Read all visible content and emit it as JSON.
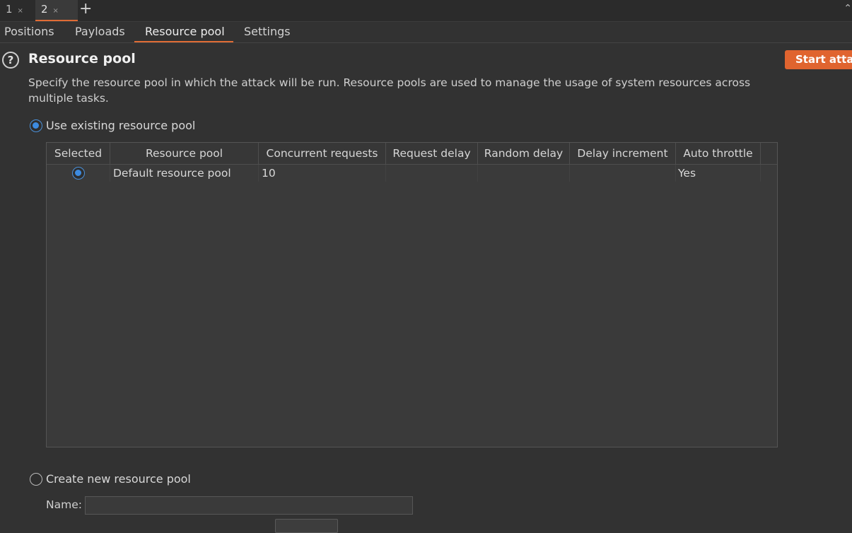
{
  "tabs": [
    {
      "label": "1",
      "close": "×"
    },
    {
      "label": "2",
      "close": "×"
    }
  ],
  "add_tab_icon": "+",
  "subtabs": [
    "Positions",
    "Payloads",
    "Resource pool",
    "Settings"
  ],
  "active_subtab": "Resource pool",
  "section": {
    "title": "Resource pool",
    "help_icon": "?",
    "description": "Specify the resource pool in which the attack will be run. Resource pools are used to manage the usage of system resources across multiple tasks.",
    "start_button": "Start attack"
  },
  "options": {
    "use_existing": "Use existing resource pool",
    "create_new": "Create new resource pool",
    "selected": "use_existing"
  },
  "table": {
    "columns": [
      "Selected",
      "Resource pool",
      "Concurrent requests",
      "Request delay",
      "Random delay",
      "Delay increment",
      "Auto throttle"
    ],
    "rows": [
      {
        "selected": true,
        "resource_pool": "Default resource pool",
        "concurrent_requests": "10",
        "request_delay": "",
        "random_delay": "",
        "delay_increment": "",
        "auto_throttle": "Yes"
      }
    ]
  },
  "new_pool": {
    "name_label": "Name:",
    "name_value": ""
  },
  "colors": {
    "accent": "#e06c35",
    "start_button": "#e0642f",
    "radio_selected": "#3d8be0",
    "background": "#323232"
  }
}
